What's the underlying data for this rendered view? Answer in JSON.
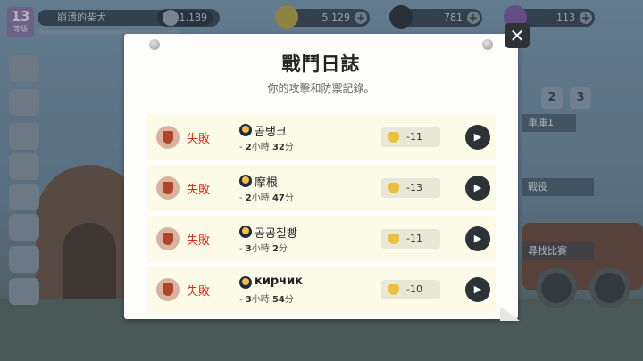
{
  "hud": {
    "level": "13",
    "level_sub": "等級",
    "player_name": "崩潰的柴犬",
    "xp_text": "",
    "trophies": "1,189",
    "coins": "5,129",
    "bombs": "781",
    "gems": "113"
  },
  "background": {
    "tabs": [
      "2",
      "3"
    ],
    "garage_label": "車庫1",
    "campaign_label": "戰役",
    "find_match_label": "尋找比賽"
  },
  "modal": {
    "title": "戰鬥日誌",
    "subtitle": "你的攻擊和防禦記錄。",
    "close_label": "✕"
  },
  "battles": [
    {
      "result": "失敗",
      "opponent": "곰탱크",
      "time_prefix": "- ",
      "hours": "2",
      "hours_unit": "小時",
      "minutes": "32",
      "minutes_unit": "分",
      "trophy_change": "-11"
    },
    {
      "result": "失敗",
      "opponent": "摩根",
      "time_prefix": "- ",
      "hours": "2",
      "hours_unit": "小時",
      "minutes": "47",
      "minutes_unit": "分",
      "trophy_change": "-13"
    },
    {
      "result": "失敗",
      "opponent": "공공칠빵",
      "time_prefix": "- ",
      "hours": "3",
      "hours_unit": "小時",
      "minutes": "2",
      "minutes_unit": "分",
      "trophy_change": "-11"
    },
    {
      "result": "失敗",
      "opponent": "кирчик",
      "time_prefix": "- ",
      "hours": "3",
      "hours_unit": "小時",
      "minutes": "54",
      "minutes_unit": "分",
      "trophy_change": "-10"
    }
  ],
  "colors": {
    "loss_red": "#d9301f",
    "modal_bg": "#fdfdfb",
    "row_bg": "#fbfbe8",
    "button_dark": "#2d3237"
  }
}
